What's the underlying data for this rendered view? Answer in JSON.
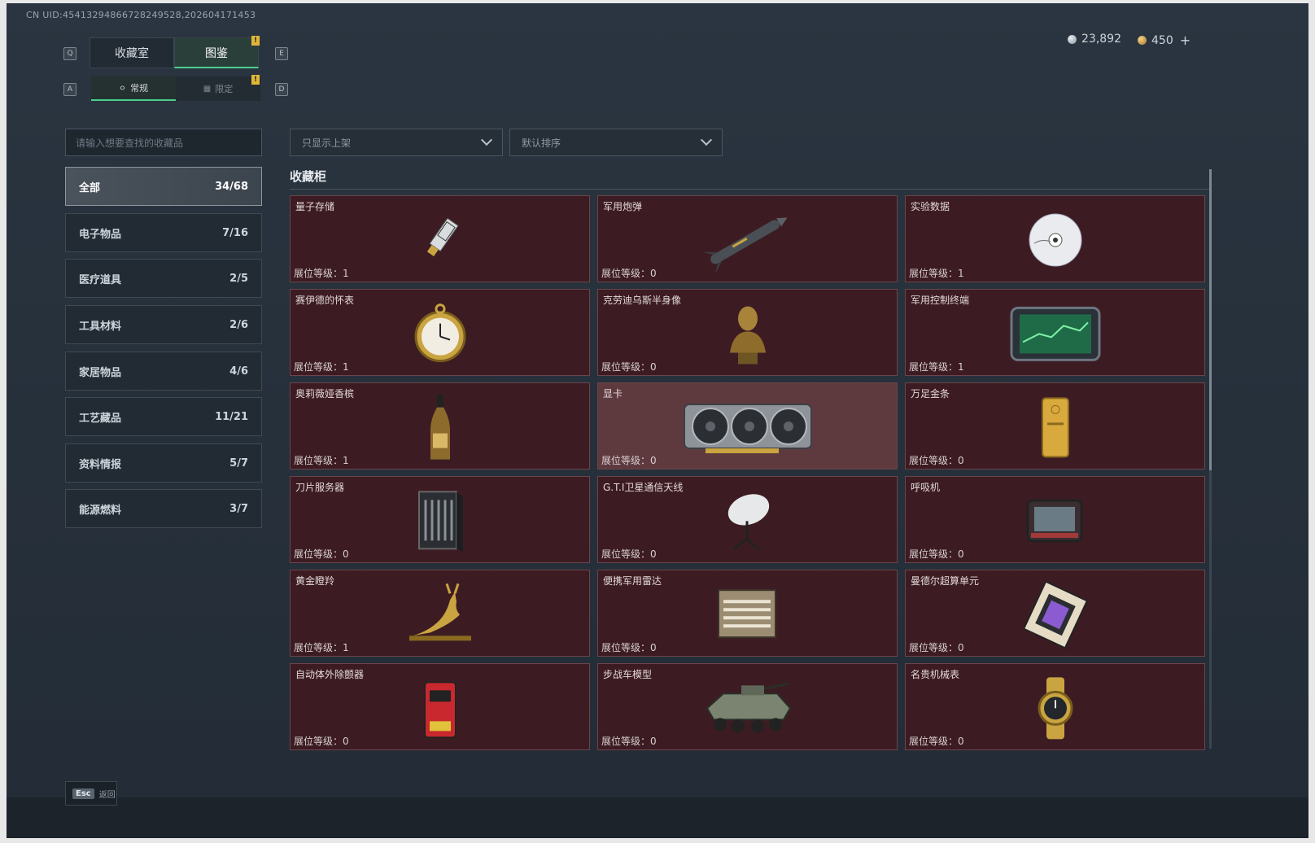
{
  "uid": "CN UID:45413294866728249528,202604171453",
  "hotkeys": {
    "tab_prev": "Q",
    "tab_next": "E",
    "sub_prev": "A",
    "sub_next": "D"
  },
  "tabs": [
    {
      "label": "收藏室",
      "active": false
    },
    {
      "label": "图鉴",
      "active": true
    }
  ],
  "tabs_badge": "!",
  "subtabs": [
    {
      "label": "常规",
      "active": true
    },
    {
      "label": "限定",
      "active": false
    }
  ],
  "subtabs_badge": "!",
  "currency": {
    "silver": "23,892",
    "gold": "450",
    "add": "+"
  },
  "search": {
    "placeholder": "请输入想要查找的收藏品"
  },
  "filters": {
    "show_filter": "只显示上架",
    "sort": "默认排序"
  },
  "categories": [
    {
      "label": "全部",
      "count": "34/68",
      "active": true
    },
    {
      "label": "电子物品",
      "count": "7/16"
    },
    {
      "label": "医疗道具",
      "count": "2/5"
    },
    {
      "label": "工具材料",
      "count": "2/6"
    },
    {
      "label": "家居物品",
      "count": "4/6"
    },
    {
      "label": "工艺藏品",
      "count": "11/21"
    },
    {
      "label": "资料情报",
      "count": "5/7"
    },
    {
      "label": "能源燃料",
      "count": "3/7"
    }
  ],
  "section_title": "收藏柜",
  "level_prefix": "展位等级：",
  "items": [
    {
      "name": "量子存储",
      "level": "1",
      "icon": "usb-drive-icon"
    },
    {
      "name": "军用炮弹",
      "level": "0",
      "icon": "missile-icon"
    },
    {
      "name": "实验数据",
      "level": "1",
      "icon": "disc-icon"
    },
    {
      "name": "赛伊德的怀表",
      "level": "1",
      "icon": "pocket-watch-icon"
    },
    {
      "name": "克劳迪乌斯半身像",
      "level": "0",
      "icon": "bust-icon"
    },
    {
      "name": "军用控制终端",
      "level": "1",
      "icon": "terminal-icon"
    },
    {
      "name": "奥莉薇娅香槟",
      "level": "1",
      "icon": "champagne-icon"
    },
    {
      "name": "显卡",
      "level": "0",
      "icon": "gpu-icon",
      "hover": true
    },
    {
      "name": "万足金条",
      "level": "0",
      "icon": "gold-bar-icon"
    },
    {
      "name": "刀片服务器",
      "level": "0",
      "icon": "server-icon"
    },
    {
      "name": "G.T.I卫星通信天线",
      "level": "0",
      "icon": "satellite-dish-icon"
    },
    {
      "name": "呼吸机",
      "level": "0",
      "icon": "ventilator-icon"
    },
    {
      "name": "黄金瞪羚",
      "level": "1",
      "icon": "gazelle-icon"
    },
    {
      "name": "便携军用雷达",
      "level": "0",
      "icon": "radar-icon"
    },
    {
      "name": "曼德尔超算单元",
      "level": "0",
      "icon": "cpu-icon"
    },
    {
      "name": "自动体外除颤器",
      "level": "0",
      "icon": "defibrillator-icon"
    },
    {
      "name": "步战车模型",
      "level": "0",
      "icon": "ifv-model-icon"
    },
    {
      "name": "名贵机械表",
      "level": "0",
      "icon": "wristwatch-icon"
    }
  ],
  "footer": {
    "esc_key": "Esc",
    "esc_label": "返回"
  },
  "colors": {
    "accent": "#4ad08a",
    "card_bg": "#3c1c22",
    "badge": "#e2b737"
  }
}
